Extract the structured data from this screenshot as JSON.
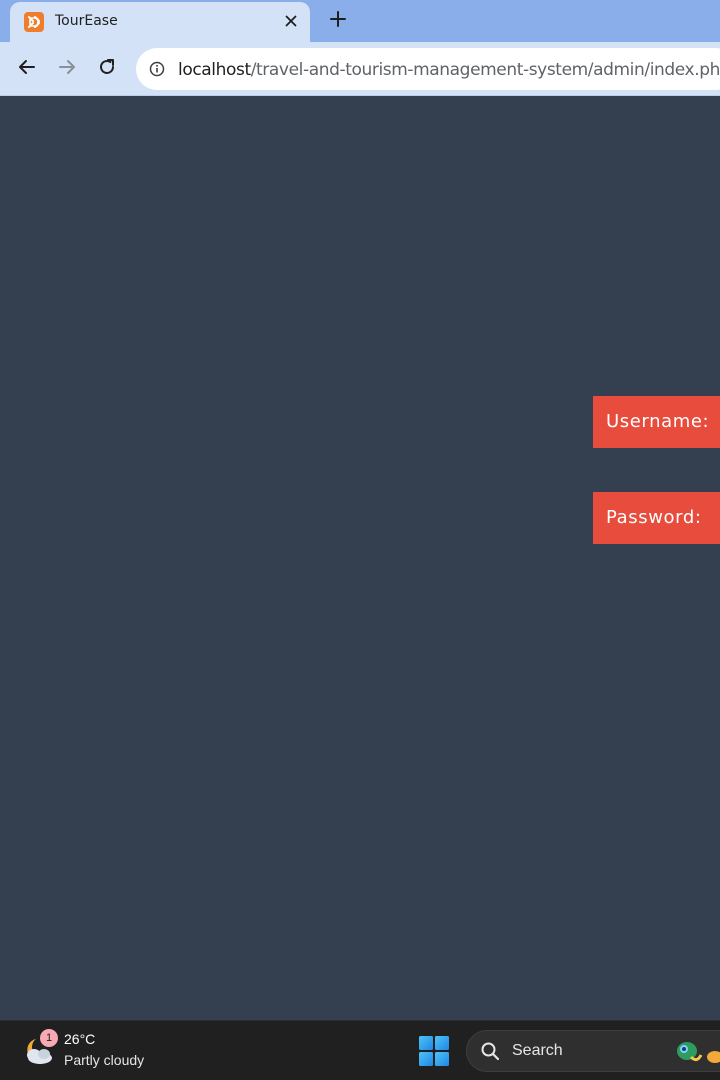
{
  "browser": {
    "tab": {
      "title": "TourEase",
      "favicon": "xampp-icon",
      "close_icon": "close-icon"
    },
    "new_tab_icon": "plus-icon",
    "toolbar": {
      "back_icon": "arrow-left-icon",
      "forward_icon": "arrow-right-icon",
      "reload_icon": "reload-icon",
      "site_info_icon": "info-icon"
    },
    "address_bar": {
      "host": "localhost",
      "path": "/travel-and-tourism-management-system/admin/index.php"
    }
  },
  "page": {
    "background_color": "#34404f",
    "accent_color": "#e74c3c",
    "form": {
      "username_label": "Username:",
      "password_label": "Password:"
    }
  },
  "taskbar": {
    "weather": {
      "temperature": "26°C",
      "condition": "Partly cloudy",
      "badge_count": "1",
      "icon": "partly-cloudy-night-icon"
    },
    "start_icon": "windows-start-icon",
    "search": {
      "label": "Search",
      "icon": "search-icon"
    }
  }
}
